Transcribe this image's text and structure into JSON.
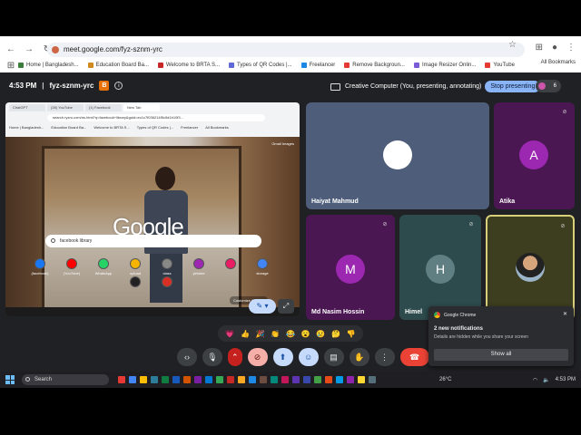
{
  "browser": {
    "url": "meet.google.com/fyz-sznm-yrc",
    "all_bookmarks": "All Bookmarks",
    "bookmarks": [
      {
        "label": "Home | Bangladesh...",
        "color": "#3b7d3b"
      },
      {
        "label": "Education Board Ba...",
        "color": "#d08a1e"
      },
      {
        "label": "Welcome to BRTA S...",
        "color": "#c62828"
      },
      {
        "label": "Types of QR Codes |...",
        "color": "#5f6ad8"
      },
      {
        "label": "Freelancer",
        "color": "#1e88e5"
      },
      {
        "label": "Remove Backgroun...",
        "color": "#e53935"
      },
      {
        "label": "Image Resizer Onlin...",
        "color": "#7b5cd8"
      },
      {
        "label": "YouTube",
        "color": "#e53935"
      }
    ]
  },
  "meet": {
    "time": "4:53 PM",
    "code": "fyz-sznm-yrc",
    "badge": "B",
    "presenting_text": "Creative Computer (You, presenting, annotating)",
    "stop_label": "Stop presenting",
    "participant_count": "6",
    "participants": [
      {
        "name": "Haiyat Mahmud",
        "initial": "",
        "avatar_color": "#ffffff"
      },
      {
        "name": "Atika",
        "initial": "A",
        "avatar_color": "#9c27b0"
      },
      {
        "name": "Md Nasim Hossin",
        "initial": "M",
        "avatar_color": "#9c27b0"
      },
      {
        "name": "Himel",
        "initial": "H",
        "avatar_color": "#5f7f82"
      }
    ],
    "reactions": [
      "💗",
      "👍",
      "🎉",
      "👏",
      "😂",
      "😮",
      "😢",
      "🤔",
      "👎"
    ]
  },
  "shared_screen": {
    "tabs": [
      "ChatGPT",
      "(28) YouTube",
      "(1) Facebook",
      "New Tab"
    ],
    "url": "search.ryzro.com/ns.html?q=facebook+library&guid=ec1c7f036214f5c5d1b10f3...",
    "bookmarks": [
      "Home | Bangladesh...",
      "Education Board Ba...",
      "Welcome to BRTA S...",
      "Types of QR Codes |...",
      "Freelancer",
      "All Bookmarks"
    ],
    "google_logo": "Google",
    "search_value": "facebook library",
    "top_links": "Gmail  Images",
    "customize": "Customize Chrome",
    "shortcuts": [
      {
        "label": "(facebook)",
        "color": "#1877f2"
      },
      {
        "label": "(YouTube)",
        "color": "#ff0000"
      },
      {
        "label": "WhatsApp",
        "color": "#25d366"
      },
      {
        "label": "upload",
        "color": "#f4b400"
      },
      {
        "label": "class",
        "color": "#888888"
      },
      {
        "label": "yt/store",
        "color": "#9c27b0"
      },
      {
        "label": "",
        "color": "#e91e63"
      },
      {
        "label": "storage",
        "color": "#4285f4"
      },
      {
        "label": "",
        "color": "#222222"
      },
      {
        "label": "",
        "color": "#d93025"
      }
    ]
  },
  "notification": {
    "app": "Google Chrome",
    "title": "2 new notifications",
    "body": "Details are hidden while you share your screen",
    "action": "Show all"
  },
  "taskbar": {
    "search_placeholder": "Search",
    "weather": "26°C",
    "time": "4:53 PM",
    "apps": [
      "#e53935",
      "#4285f4",
      "#fbbc04",
      "#2d7d9a",
      "#107c41",
      "#185abc",
      "#d35400",
      "#7b1fa2",
      "#0078d4",
      "#34a853",
      "#c62828",
      "#f9a825",
      "#1e88e5",
      "#6d4c41",
      "#00897b",
      "#c2185b",
      "#5e35b1",
      "#3949ab",
      "#43a047",
      "#e64a19",
      "#039be5",
      "#8e24aa",
      "#fdd835",
      "#546e7a"
    ]
  }
}
